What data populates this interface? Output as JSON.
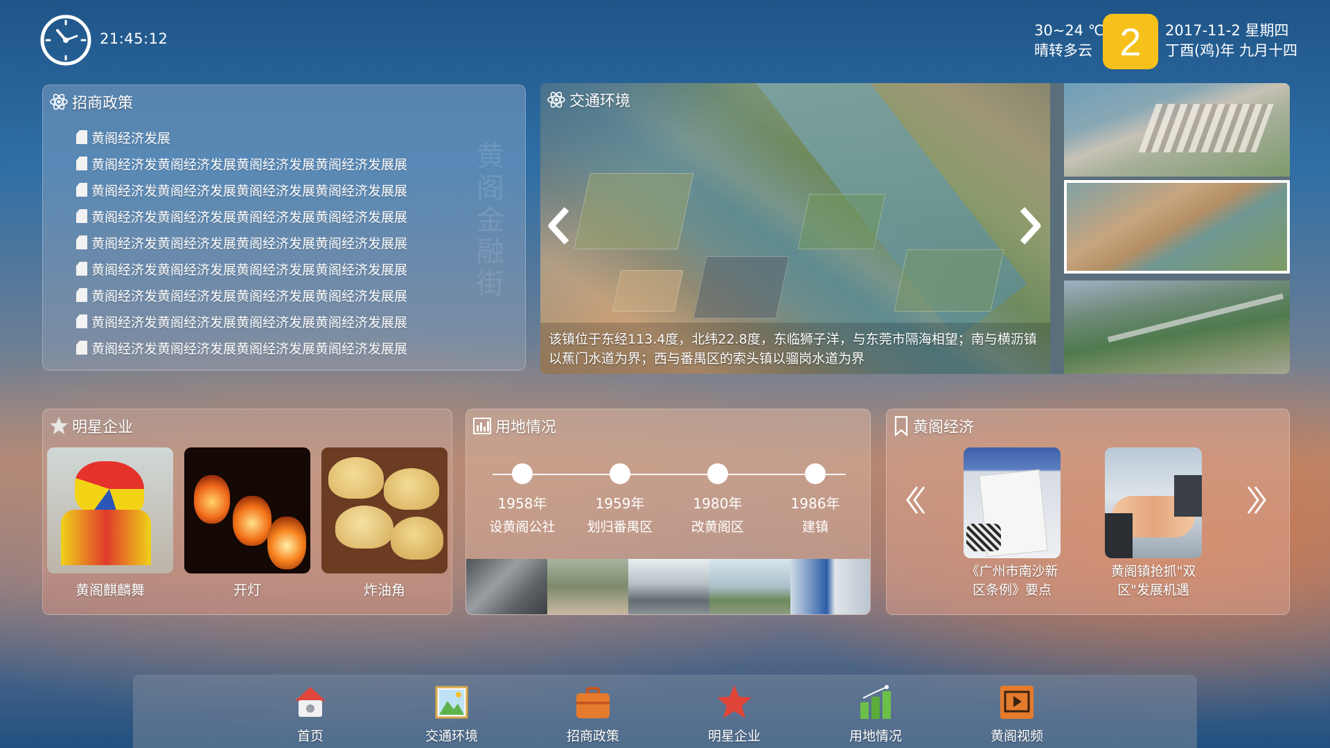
{
  "header": {
    "time": "21:45:12",
    "weather_temp": "30~24 ℃",
    "weather_desc": "晴转多云",
    "day_number": "2",
    "date_line": "2017-11-2 星期四",
    "lunar_line": "丁酉(鸡)年 九月十四"
  },
  "policy": {
    "title": "招商政策",
    "items": [
      "黄阁经济发展",
      "黄阁经济发黄阁经济发展黄阁经济发展黄阁经济发展展",
      "黄阁经济发黄阁经济发展黄阁经济发展黄阁经济发展展",
      "黄阁经济发黄阁经济发展黄阁经济发展黄阁经济发展展",
      "黄阁经济发黄阁经济发展黄阁经济发展黄阁经济发展展",
      "黄阁经济发黄阁经济发展黄阁经济发展黄阁经济发展展",
      "黄阁经济发黄阁经济发展黄阁经济发展黄阁经济发展展",
      "黄阁经济发黄阁经济发展黄阁经济发展黄阁经济发展展",
      "黄阁经济发黄阁经济发展黄阁经济发展黄阁经济发展展"
    ],
    "watermark": "黄阁金融街"
  },
  "traffic": {
    "title": "交通环境",
    "caption": "该镇位于东经113.4度，北纬22.8度，东临狮子洋，与东莞市隔海相望；南与横沥镇以蕉门水道为界；西与番禺区的索头镇以骝岗水道为界"
  },
  "stars": {
    "title": "明星企业",
    "items": [
      {
        "label": "黄阁麒麟舞"
      },
      {
        "label": "开灯"
      },
      {
        "label": "炸油角"
      }
    ]
  },
  "land": {
    "title": "用地情况",
    "timeline": [
      {
        "year": "1958年",
        "desc": "设黄阁公社"
      },
      {
        "year": "1959年",
        "desc": "划归番禺区"
      },
      {
        "year": "1980年",
        "desc": "改黄阁区"
      },
      {
        "year": "1986年",
        "desc": "建镇"
      }
    ]
  },
  "econ": {
    "title": "黄阁经济",
    "items": [
      {
        "label": "《广州市南沙新区条例》要点"
      },
      {
        "label": "黄阁镇抢抓\"双区\"发展机遇"
      }
    ]
  },
  "dock": {
    "items": [
      {
        "label": "首页",
        "icon": "home-icon"
      },
      {
        "label": "交通环境",
        "icon": "picture-icon"
      },
      {
        "label": "招商政策",
        "icon": "briefcase-icon"
      },
      {
        "label": "明星企业",
        "icon": "star-icon"
      },
      {
        "label": "用地情况",
        "icon": "chart-icon"
      },
      {
        "label": "黄阁视频",
        "icon": "video-icon"
      }
    ]
  },
  "colors": {
    "day_badge": "#f6c11b",
    "accent_red": "#e0453a",
    "accent_orange": "#e57b2d",
    "accent_green": "#6cc04a"
  }
}
